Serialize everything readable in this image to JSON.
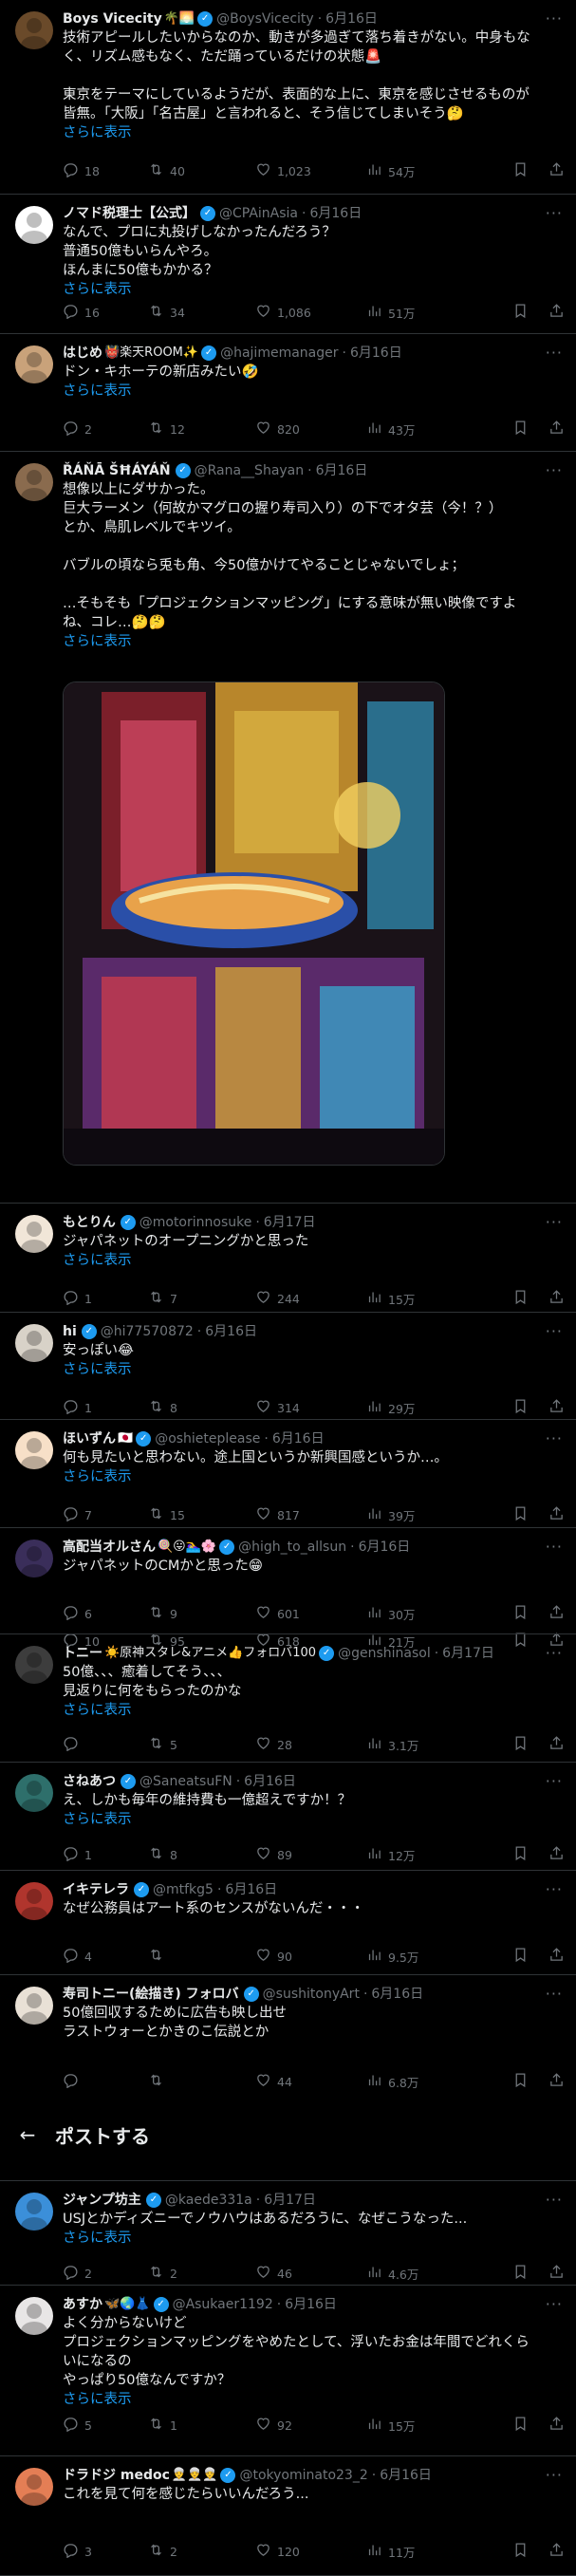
{
  "icons": {
    "reply": "reply-icon",
    "retweet": "retweet-icon",
    "like": "heart-icon",
    "views": "views-icon",
    "bookmark": "bookmark-icon",
    "share": "share-icon"
  },
  "header_bar": {
    "back": "←",
    "title": "ポストする"
  },
  "tweets": [
    {
      "name": "Boys Vicecity",
      "emoji": "🌴🌅",
      "handle": "@BoysVicecity",
      "dot": "·",
      "date": "6月16日",
      "verified": true,
      "lines": [
        "技術アピールしたいからなのか、動きが多過ぎて落ち着きがない。中身もな",
        "く、リズム感もなく、ただ踊っているだけの状態🚨",
        "",
        "東京をテーマにしているようだが、表面的な上に、東京を感じさせるものが",
        "皆無。「大阪」「名古屋」と言われると、そう信じてしまいそう🤔"
      ],
      "show_more": "さらに表示",
      "stats": {
        "reply": "18",
        "retweet": "40",
        "like": "1,023",
        "views": "54万"
      }
    },
    {
      "name": "ノマド税理士【公式】",
      "emoji": "",
      "handle": "@CPAinAsia",
      "dot": "·",
      "date": "6月16日",
      "verified": true,
      "lines": [
        "なんで、プロに丸投げしなかったんだろう？",
        "普通50億もいらんやろ。",
        "ほんまに50億もかかる？"
      ],
      "show_more": "さらに表示",
      "stats": {
        "reply": "16",
        "retweet": "34",
        "like": "1,086",
        "views": "51万"
      }
    },
    {
      "name": "はじめ",
      "emoji": "👹楽天ROOM✨",
      "handle": "@hajimemanager",
      "dot": "·",
      "date": "6月16日",
      "verified": true,
      "lines": [
        "ドン・キホーテの新店みたい🤣"
      ],
      "show_more": "さらに表示",
      "stats": {
        "reply": "2",
        "retweet": "12",
        "like": "820",
        "views": "43万"
      }
    },
    {
      "name": "ŘÁŇĀ ŠĦÁYÁŇ",
      "emoji": "",
      "handle": "@Rana__Shayan",
      "dot": "·",
      "date": "6月16日",
      "verified": true,
      "lines": [
        "想像以上にダサかった。",
        "巨大ラーメン（何故かマグロの握り寿司入り）の下でオタ芸（今！？）",
        "とか、鳥肌レベルでキツイ。",
        "",
        "バブルの頃なら兎も角、今50億かけてやることじゃないでしょ；",
        "",
        "…そもそも「プロジェクションマッピング」にする意味が無い映像ですよ",
        "ね、コレ…🤔🤔"
      ],
      "show_more": "さらに表示",
      "stats": {
        "reply": "10",
        "retweet": "95",
        "like": "618",
        "views": "21万"
      }
    },
    {
      "name": "もとりん",
      "emoji": "",
      "handle": "@motorinnosuke",
      "dot": "·",
      "date": "6月17日",
      "verified": true,
      "lines": [
        "ジャパネットのオープニングかと思った"
      ],
      "show_more": "さらに表示",
      "stats": {
        "reply": "1",
        "retweet": "7",
        "like": "244",
        "views": "15万"
      }
    },
    {
      "name": "hi",
      "emoji": "",
      "handle": "@hi77570872",
      "dot": "·",
      "date": "6月16日",
      "verified": true,
      "lines": [
        "安っぽい😂"
      ],
      "show_more": "さらに表示",
      "stats": {
        "reply": "1",
        "retweet": "8",
        "like": "314",
        "views": "29万"
      }
    },
    {
      "name": "ほいずん",
      "emoji": "🇯🇵",
      "handle": "@oshieteplease",
      "dot": "·",
      "date": "6月16日",
      "verified": true,
      "lines": [
        "何も見たいと思わない。途上国というか新興国感というか…。"
      ],
      "show_more": "さらに表示",
      "stats": {
        "reply": "7",
        "retweet": "15",
        "like": "817",
        "views": "39万"
      }
    },
    {
      "name": "高配当オルさん",
      "emoji": "🍭😛🏊‍♀️🌸",
      "handle": "@high_to_allsun",
      "dot": "·",
      "date": "6月16日",
      "verified": true,
      "lines": [
        "ジャパネットのCMかと思った😁"
      ],
      "show_more": "",
      "stats": {
        "reply": "6",
        "retweet": "9",
        "like": "601",
        "views": "30万"
      }
    },
    {
      "name": "トニー",
      "emoji": "☀️原神スタレ&アニメ👍フォロバ100",
      "handle": "@genshinasol",
      "dot": "·",
      "date": "6月17日",
      "verified": true,
      "lines": [
        "50億、、、癒着してそう、、、",
        "見返りに何をもらったのかな"
      ],
      "show_more": "さらに表示",
      "stats": {
        "reply": "",
        "retweet": "5",
        "like": "28",
        "views": "3.1万"
      }
    },
    {
      "name": "さねあつ",
      "emoji": "",
      "handle": "@SaneatsuFN",
      "dot": "·",
      "date": "6月16日",
      "verified": true,
      "lines": [
        "え、しかも毎年の維持費も一億超えですか！？"
      ],
      "show_more": "さらに表示",
      "stats": {
        "reply": "1",
        "retweet": "8",
        "like": "89",
        "views": "12万"
      }
    },
    {
      "name": "イキテレラ",
      "emoji": "",
      "handle": "@mtfkg5",
      "dot": "·",
      "date": "6月16日",
      "verified": true,
      "lines": [
        "なぜ公務員はアート系のセンスがないんだ・・・"
      ],
      "show_more": "",
      "stats": {
        "reply": "4",
        "retweet": "",
        "like": "90",
        "views": "9.5万"
      }
    },
    {
      "name": "寿司トニー(絵描き) フォロバ",
      "emoji": "",
      "handle": "@sushitonyArt",
      "dot": "·",
      "date": "6月16日",
      "verified": true,
      "lines": [
        "50億回収するために広告も映し出せ",
        "ラストウォーとかきのこ伝説とか"
      ],
      "show_more": "",
      "stats": {
        "reply": "",
        "retweet": "",
        "like": "44",
        "views": "6.8万"
      }
    },
    {
      "name": "ジャンプ坊主",
      "emoji": "",
      "handle": "@kaede331a",
      "dot": "·",
      "date": "6月17日",
      "verified": true,
      "lines": [
        "USJとかディズニーでノウハウはあるだろうに、なぜこうなった..."
      ],
      "show_more": "さらに表示",
      "stats": {
        "reply": "2",
        "retweet": "2",
        "like": "46",
        "views": "4.6万"
      }
    },
    {
      "name": "あすか",
      "emoji": "🦋🌏👗",
      "handle": "@Asukaer1192",
      "dot": "·",
      "date": "6月16日",
      "verified": true,
      "lines": [
        "よく分からないけど",
        "プロジェクションマッピングをやめたとして、浮いたお金は年間でどれくら",
        "いになるの",
        "やっぱり50億なんですか？"
      ],
      "show_more": "さらに表示",
      "stats": {
        "reply": "5",
        "retweet": "1",
        "like": "92",
        "views": "15万"
      }
    },
    {
      "name": "ドラドジ medoc",
      "emoji": "👳‍♂️👳‍♂️👳‍♂️",
      "handle": "@tokyominato23_2",
      "dot": "·",
      "date": "6月16日",
      "verified": true,
      "lines": [
        "これを見て何を感じたらいいんだろう..."
      ],
      "show_more": "",
      "stats": {
        "reply": "3",
        "retweet": "2",
        "like": "120",
        "views": "11万"
      }
    }
  ]
}
